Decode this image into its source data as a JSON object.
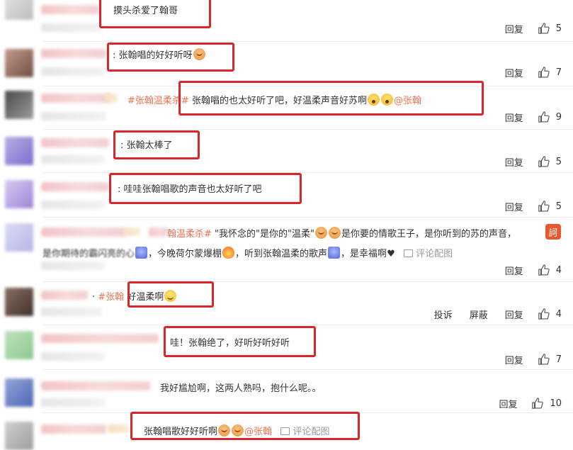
{
  "actions": {
    "reply": "回复",
    "report": "投诉",
    "block": "屏蔽"
  },
  "colors": {
    "highlight": "#d8262a",
    "topic": "#eb7350",
    "like_icon": "#555555"
  },
  "comments": [
    {
      "text": "摸头杀爱了翰哥",
      "likes": "5"
    },
    {
      "text": "张翰唱的好好听呀",
      "emoji": "hug-icon",
      "likes": "7"
    },
    {
      "topic": "#张翰温柔杀#",
      "text": "张翰唱的也太好听了吧，好温柔声音好苏啊",
      "emoji": "shock-icon",
      "mention": "@张翰",
      "likes": "9"
    },
    {
      "text": "张翰太棒了",
      "likes": "5"
    },
    {
      "text": "哇哇张翰唱歌的声音也太好听了吧",
      "likes": "5"
    },
    {
      "topic": "翰温柔杀#",
      "text_a": "\"我怀念的\"是你的\"温柔\"",
      "text_b": "是你要的情歌王子，是你听到的苏的声音，",
      "text_c": "是你期待的霸闪亮的心",
      "text_d": "，今晚荷尔蒙爆棚",
      "text_e": "，听到张翰温柔的歌声",
      "text_f": "，是幸福啊",
      "heart": "♥",
      "pic_link": "评论配图",
      "likes": "4"
    },
    {
      "topic": "#张翰",
      "text": "好温柔啊",
      "emoji": "smile-icon",
      "likes": "4"
    },
    {
      "text": "哇！张翰绝了，好听好听好听",
      "likes": "7"
    },
    {
      "text": "我好尴尬啊，这两人熟吗，抱什么呢。。",
      "likes": "10"
    },
    {
      "text": "张翰唱歌好好听啊",
      "mention": "@张翰",
      "pic_link": "评论配图"
    }
  ]
}
